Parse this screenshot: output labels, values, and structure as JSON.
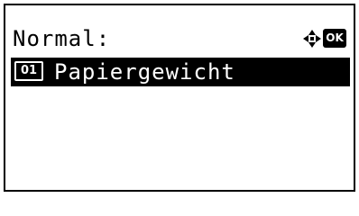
{
  "header": {
    "title": "Normal:",
    "nav_icon": "four-way-arrow-icon",
    "ok_label": "OK"
  },
  "menu": {
    "items": [
      {
        "index": "01",
        "label": "Papiergewicht",
        "selected": true
      }
    ]
  },
  "colors": {
    "foreground": "#000000",
    "background": "#ffffff",
    "highlight": "#000000",
    "highlight_text": "#ffffff"
  }
}
